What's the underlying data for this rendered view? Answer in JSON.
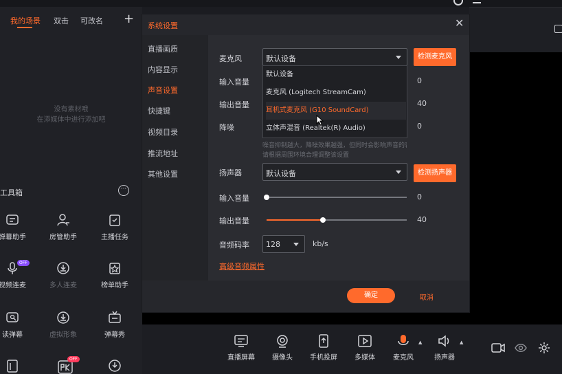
{
  "scene_panel": {
    "tabs": [
      {
        "label": "我的场景",
        "active": true
      },
      {
        "label": "双击"
      },
      {
        "label": "可改名"
      }
    ],
    "add_label": "+",
    "empty_hint_line1": "没有素材哦",
    "empty_hint_line2": "在添媒体中进行添加吧"
  },
  "toolbox": {
    "title": "工具箱",
    "more_label": "···",
    "items": [
      {
        "label": "弹幕助手",
        "icon": "danmaku-icon"
      },
      {
        "label": "房管助手",
        "icon": "user-manager-icon"
      },
      {
        "label": "主播任务",
        "icon": "task-icon"
      },
      {
        "label": "视频连麦",
        "icon": "mic-link-icon",
        "badge": "OFF"
      },
      {
        "label": "多人连麦",
        "icon": "download-icon",
        "dim": true
      },
      {
        "label": "榜单助手",
        "icon": "star-board-icon"
      },
      {
        "label": "读弹幕",
        "icon": "read-danmaku-icon"
      },
      {
        "label": "虚拟形象",
        "icon": "download-icon",
        "dim": true
      },
      {
        "label": "弹幕秀",
        "icon": "tv-icon"
      }
    ],
    "bottom_badge": "OFF"
  },
  "dialog": {
    "title": "系统设置",
    "close_label": "✕",
    "nav": [
      {
        "label": "直播画质"
      },
      {
        "label": "内容显示"
      },
      {
        "label": "声音设置",
        "active": true
      },
      {
        "label": "快捷键"
      },
      {
        "label": "视频目录"
      },
      {
        "label": "推流地址"
      },
      {
        "label": "其他设置"
      }
    ],
    "mic": {
      "label": "麦克风",
      "selected": "默认设备",
      "test_button": "检测麦克风",
      "options": [
        "默认设备",
        "麦克风 (Logitech StreamCam)",
        "耳机式麦克风 (G10 SoundCard)",
        "立体声混音 (Realtek(R) Audio)"
      ],
      "highlighted_index": 2,
      "input_level_label": "输入音量",
      "input_level_value": "0",
      "output_volume_label": "输出音量",
      "output_volume_value": "40",
      "noise_label": "降噪",
      "noise_value": "0",
      "noise_hint_line1": "噪音抑制越大，降噪效果越强，但同时会影响声音的表现",
      "noise_hint_line2": "请根据周围环境合理调整该设置"
    },
    "speaker": {
      "label": "扬声器",
      "selected": "默认设备",
      "test_button": "检测扬声器",
      "input_level_label": "输入音量",
      "input_level_value": "0",
      "input_level_fraction": 0.0,
      "output_volume_label": "输出音量",
      "output_volume_value": "40",
      "output_volume_fraction": 0.4
    },
    "bitrate": {
      "label": "音频码率",
      "value": "128",
      "unit": "kb/s"
    },
    "advanced_link": "高级音频属性",
    "ok_button": "确定",
    "cancel_button": "取消"
  },
  "bottom_bar": {
    "items": [
      {
        "label": "直播屏幕",
        "icon": "screen-share-icon"
      },
      {
        "label": "摄像头",
        "icon": "camera-icon"
      },
      {
        "label": "手机投屏",
        "icon": "phone-cast-icon"
      },
      {
        "label": "多媒体",
        "icon": "multimedia-icon"
      },
      {
        "label": "麦克风",
        "icon": "microphone-icon"
      },
      {
        "label": "扬声器",
        "icon": "speaker-icon"
      }
    ]
  },
  "colors": {
    "accent": "#ff6a2c",
    "dialog_bg": "#2b2c31",
    "panel_bg": "#202126"
  }
}
